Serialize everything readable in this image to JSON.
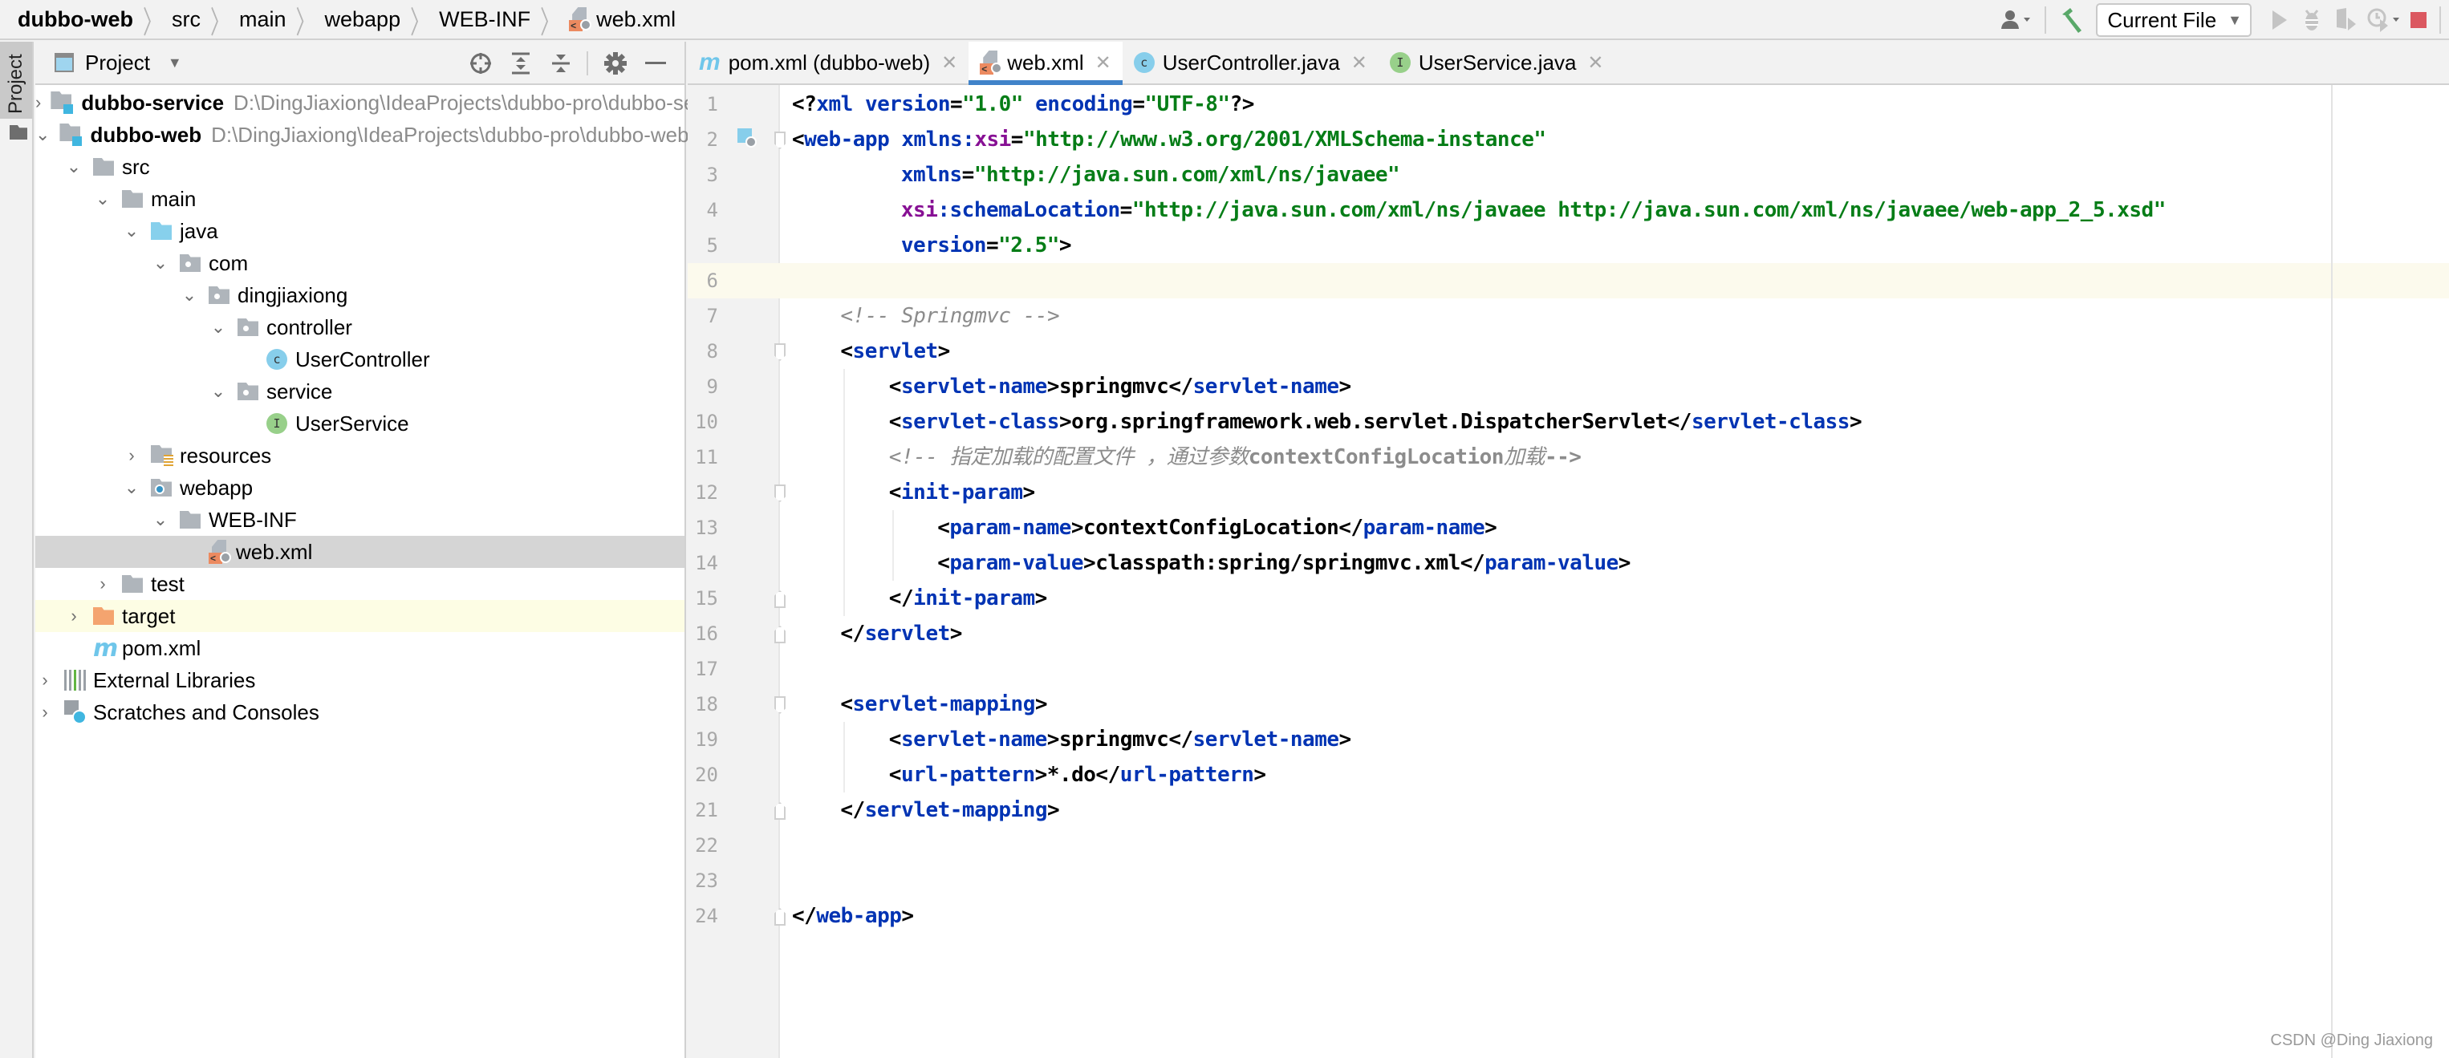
{
  "breadcrumb": [
    "dubbo-web",
    "src",
    "main",
    "webapp",
    "WEB-INF",
    "web.xml"
  ],
  "toolbar": {
    "run_config": "Current File",
    "icons": [
      "user-vcs-icon",
      "build-hammer-icon",
      "run-icon",
      "debug-icon",
      "coverage-icon",
      "profile-icon",
      "stop-icon"
    ],
    "colors": {
      "build": "#59a869",
      "stop": "#db5860"
    }
  },
  "tool_strip": {
    "label": "Project"
  },
  "project_panel": {
    "title": "Project",
    "tree": [
      {
        "label": "dubbo-service",
        "path": "D:\\DingJiaxiong\\IdeaProjects\\dubbo-pro\\dubbo-service",
        "depth": 0,
        "state": "collapsed",
        "icon": "module"
      },
      {
        "label": "dubbo-web",
        "path": "D:\\DingJiaxiong\\IdeaProjects\\dubbo-pro\\dubbo-web",
        "depth": 0,
        "state": "expanded",
        "icon": "module"
      },
      {
        "label": "src",
        "depth": 1,
        "state": "expanded",
        "icon": "folder"
      },
      {
        "label": "main",
        "depth": 2,
        "state": "expanded",
        "icon": "folder"
      },
      {
        "label": "java",
        "depth": 3,
        "state": "expanded",
        "icon": "source-folder"
      },
      {
        "label": "com",
        "depth": 4,
        "state": "expanded",
        "icon": "package"
      },
      {
        "label": "dingjiaxiong",
        "depth": 5,
        "state": "expanded",
        "icon": "package"
      },
      {
        "label": "controller",
        "depth": 6,
        "state": "expanded",
        "icon": "package"
      },
      {
        "label": "UserController",
        "depth": 7,
        "state": "leaf",
        "icon": "class"
      },
      {
        "label": "service",
        "depth": 6,
        "state": "expanded",
        "icon": "package"
      },
      {
        "label": "UserService",
        "depth": 7,
        "state": "leaf",
        "icon": "interface"
      },
      {
        "label": "resources",
        "depth": 3,
        "state": "collapsed",
        "icon": "resources-folder"
      },
      {
        "label": "webapp",
        "depth": 3,
        "state": "expanded",
        "icon": "web-folder"
      },
      {
        "label": "WEB-INF",
        "depth": 4,
        "state": "expanded",
        "icon": "folder"
      },
      {
        "label": "web.xml",
        "depth": 5,
        "state": "leaf",
        "icon": "xml-file",
        "selected": true
      },
      {
        "label": "test",
        "depth": 2,
        "state": "collapsed",
        "icon": "folder"
      },
      {
        "label": "target",
        "depth": 1,
        "state": "collapsed",
        "icon": "excluded-folder",
        "highlighted": true
      },
      {
        "label": "pom.xml",
        "depth": 1,
        "state": "leaf",
        "icon": "maven"
      },
      {
        "label": "External Libraries",
        "depth": 0,
        "state": "collapsed",
        "icon": "libraries"
      },
      {
        "label": "Scratches and Consoles",
        "depth": 0,
        "state": "collapsed",
        "icon": "scratches"
      }
    ]
  },
  "editor": {
    "tabs": [
      {
        "label": "pom.xml (dubbo-web)",
        "icon": "maven",
        "active": false
      },
      {
        "label": "web.xml",
        "icon": "xml-file",
        "active": true
      },
      {
        "label": "UserController.java",
        "icon": "class",
        "active": false
      },
      {
        "label": "UserService.java",
        "icon": "interface",
        "active": false
      }
    ],
    "caret_line": 6,
    "lines": [
      {
        "n": "1",
        "indent": 0,
        "tokens": [
          [
            "br",
            "<?"
          ],
          [
            "tg",
            "xml "
          ],
          [
            "an",
            "version"
          ],
          [
            "br",
            "="
          ],
          [
            "av",
            "\"1.0\""
          ],
          [
            "br",
            " "
          ],
          [
            "an",
            "encoding"
          ],
          [
            "br",
            "="
          ],
          [
            "av",
            "\"UTF-8\""
          ],
          [
            "br",
            "?>"
          ]
        ]
      },
      {
        "n": "2",
        "indent": 0,
        "fold": "open",
        "gutter_icon": true,
        "tokens": [
          [
            "br",
            "<"
          ],
          [
            "tg",
            "web-app "
          ],
          [
            "an",
            "xmlns:"
          ],
          [
            "ns",
            "xsi"
          ],
          [
            "br",
            "="
          ],
          [
            "av",
            "\"http://www.w3.org/2001/XMLSchema-instance\""
          ]
        ]
      },
      {
        "n": "3",
        "indent": 9,
        "tokens": [
          [
            "an",
            "xmlns"
          ],
          [
            "br",
            "="
          ],
          [
            "av",
            "\"http://java.sun.com/xml/ns/javaee\""
          ]
        ]
      },
      {
        "n": "4",
        "indent": 9,
        "tokens": [
          [
            "ns",
            "xsi"
          ],
          [
            "an",
            ":schemaLocation"
          ],
          [
            "br",
            "="
          ],
          [
            "av",
            "\"http://java.sun.com/xml/ns/javaee http://java.sun.com/xml/ns/javaee/web-app_2_5.xsd\""
          ]
        ]
      },
      {
        "n": "5",
        "indent": 9,
        "tokens": [
          [
            "an",
            "version"
          ],
          [
            "br",
            "="
          ],
          [
            "av",
            "\"2.5\""
          ],
          [
            "br",
            ">"
          ]
        ]
      },
      {
        "n": "6",
        "indent": 0,
        "tokens": []
      },
      {
        "n": "7",
        "indent": 4,
        "tokens": [
          [
            "cm",
            "<!-- Springmvc -->"
          ]
        ]
      },
      {
        "n": "8",
        "indent": 4,
        "fold": "open",
        "tokens": [
          [
            "br",
            "<"
          ],
          [
            "tg",
            "servlet"
          ],
          [
            "br",
            ">"
          ]
        ]
      },
      {
        "n": "9",
        "indent": 8,
        "tokens": [
          [
            "br",
            "<"
          ],
          [
            "tg",
            "servlet-name"
          ],
          [
            "br",
            ">"
          ],
          [
            "tx",
            "springmvc"
          ],
          [
            "br",
            "</"
          ],
          [
            "tg",
            "servlet-name"
          ],
          [
            "br",
            ">"
          ]
        ]
      },
      {
        "n": "10",
        "indent": 8,
        "tokens": [
          [
            "br",
            "<"
          ],
          [
            "tg",
            "servlet-class"
          ],
          [
            "br",
            ">"
          ],
          [
            "tx",
            "org.springframework.web.servlet.DispatcherServlet"
          ],
          [
            "br",
            "</"
          ],
          [
            "tg",
            "servlet-class"
          ],
          [
            "br",
            ">"
          ]
        ]
      },
      {
        "n": "11",
        "indent": 8,
        "tokens": [
          [
            "cm",
            "<!-- 指定加载的配置文件 ，通过参数"
          ],
          [
            "cmb",
            "contextConfigLocation"
          ],
          [
            "cm",
            "加载"
          ],
          [
            "cmb",
            "-->"
          ]
        ]
      },
      {
        "n": "12",
        "indent": 8,
        "fold": "open",
        "tokens": [
          [
            "br",
            "<"
          ],
          [
            "tg",
            "init-param"
          ],
          [
            "br",
            ">"
          ]
        ]
      },
      {
        "n": "13",
        "indent": 12,
        "tokens": [
          [
            "br",
            "<"
          ],
          [
            "tg",
            "param-name"
          ],
          [
            "br",
            ">"
          ],
          [
            "tx",
            "contextConfigLocation"
          ],
          [
            "br",
            "</"
          ],
          [
            "tg",
            "param-name"
          ],
          [
            "br",
            ">"
          ]
        ]
      },
      {
        "n": "14",
        "indent": 12,
        "tokens": [
          [
            "br",
            "<"
          ],
          [
            "tg",
            "param-value"
          ],
          [
            "br",
            ">"
          ],
          [
            "tx",
            "classpath:spring/springmvc.xml"
          ],
          [
            "br",
            "</"
          ],
          [
            "tg",
            "param-value"
          ],
          [
            "br",
            ">"
          ]
        ]
      },
      {
        "n": "15",
        "indent": 8,
        "fold": "close",
        "tokens": [
          [
            "br",
            "</"
          ],
          [
            "tg",
            "init-param"
          ],
          [
            "br",
            ">"
          ]
        ]
      },
      {
        "n": "16",
        "indent": 4,
        "fold": "close",
        "tokens": [
          [
            "br",
            "</"
          ],
          [
            "tg",
            "servlet"
          ],
          [
            "br",
            ">"
          ]
        ]
      },
      {
        "n": "17",
        "indent": 0,
        "tokens": []
      },
      {
        "n": "18",
        "indent": 4,
        "fold": "open",
        "tokens": [
          [
            "br",
            "<"
          ],
          [
            "tg",
            "servlet-mapping"
          ],
          [
            "br",
            ">"
          ]
        ]
      },
      {
        "n": "19",
        "indent": 8,
        "tokens": [
          [
            "br",
            "<"
          ],
          [
            "tg",
            "servlet-name"
          ],
          [
            "br",
            ">"
          ],
          [
            "tx",
            "springmvc"
          ],
          [
            "br",
            "</"
          ],
          [
            "tg",
            "servlet-name"
          ],
          [
            "br",
            ">"
          ]
        ]
      },
      {
        "n": "20",
        "indent": 8,
        "tokens": [
          [
            "br",
            "<"
          ],
          [
            "tg",
            "url-pattern"
          ],
          [
            "br",
            ">"
          ],
          [
            "tx",
            "*.do"
          ],
          [
            "br",
            "</"
          ],
          [
            "tg",
            "url-pattern"
          ],
          [
            "br",
            ">"
          ]
        ]
      },
      {
        "n": "21",
        "indent": 4,
        "fold": "close",
        "tokens": [
          [
            "br",
            "</"
          ],
          [
            "tg",
            "servlet-mapping"
          ],
          [
            "br",
            ">"
          ]
        ]
      },
      {
        "n": "22",
        "indent": 0,
        "tokens": []
      },
      {
        "n": "23",
        "indent": 0,
        "tokens": []
      },
      {
        "n": "24",
        "indent": 0,
        "fold": "close",
        "tokens": [
          [
            "br",
            "</"
          ],
          [
            "tg",
            "web-app"
          ],
          [
            "br",
            ">"
          ]
        ]
      }
    ],
    "syntax_colors": {
      "tag": "#0033b3",
      "attribute": "#0033b3",
      "namespace": "#871094",
      "value": "#067d17",
      "comment": "#8c8c8c",
      "caret_line": "#fcfaed",
      "tab_underline": "#4083c9"
    }
  },
  "watermark": "CSDN @Ding Jiaxiong"
}
